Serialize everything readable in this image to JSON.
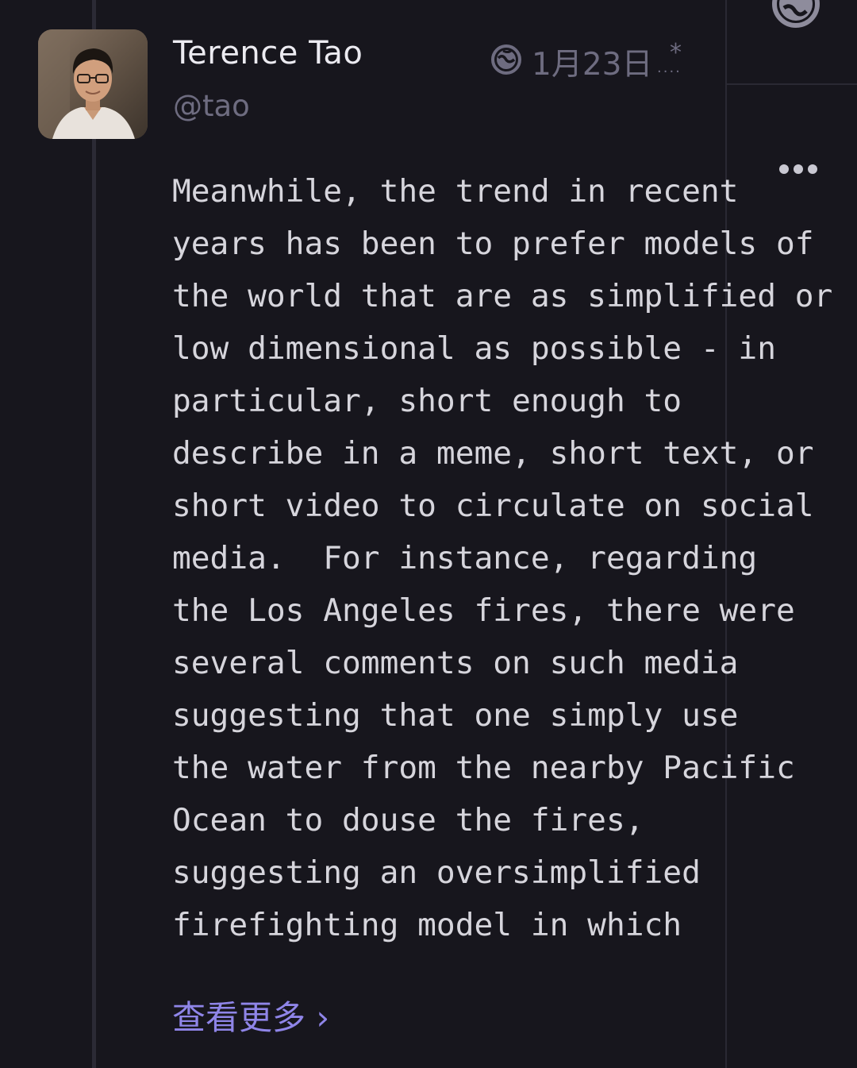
{
  "post": {
    "author": {
      "display_name": "Terence Tao",
      "handle": "@tao"
    },
    "visibility_icon": "globe-icon",
    "date": "1月23日",
    "edited_marker": "*",
    "body_lines": [
      "Meanwhile, the trend in recent",
      "years has been to prefer models of",
      "the world that are as simplified or",
      "low dimensional as possible - in",
      "particular, short enough to",
      "describe in a meme, short text, or",
      "short video to circulate on social",
      "media.  For instance, regarding",
      "the Los Angeles fires, there were",
      "several comments on such media",
      "suggesting that one simply use",
      "the water from the nearby Pacific",
      "Ocean to douse the fires,",
      "suggesting an oversimplified",
      "firefighting model in which"
    ],
    "show_more_label": "查看更多 ›"
  },
  "sidebar": {
    "top_icon": "globe-icon",
    "more_icon": "more-horizontal-icon"
  },
  "colors": {
    "background": "#17161d",
    "text_primary": "#ecebf1",
    "text_body": "#d6d5dc",
    "text_muted": "#6e6c80",
    "accent_link": "#8f85e8",
    "divider": "#2a2933"
  }
}
